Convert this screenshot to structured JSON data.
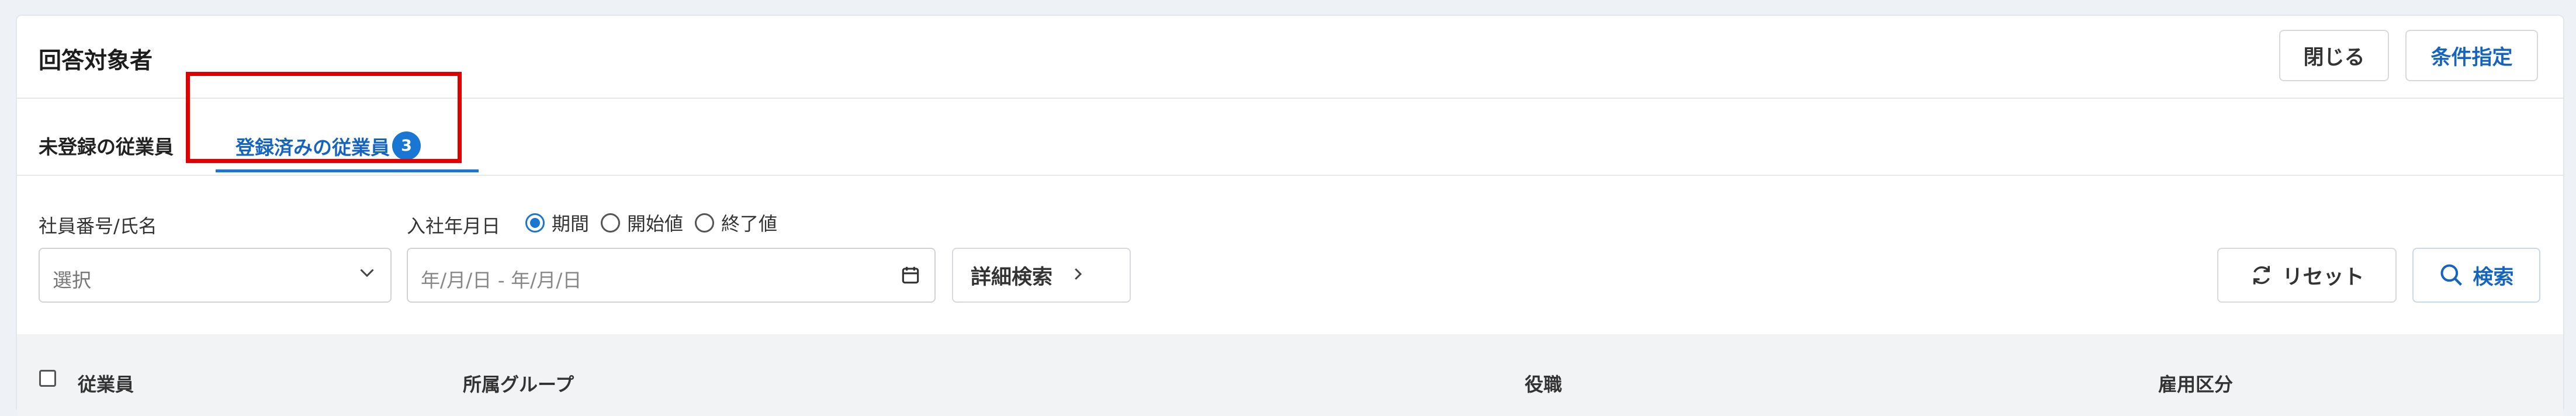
{
  "header": {
    "title": "回答対象者",
    "close_label": "閉じる",
    "condition_label": "条件指定"
  },
  "tabs": [
    {
      "label": "未登録の従業員"
    },
    {
      "label": "登録済みの従業員",
      "badge": "3",
      "active": true
    }
  ],
  "filters": {
    "employee_label": "社員番号/氏名",
    "employee_placeholder": "選択",
    "hire_date_label": "入社年月日",
    "radio_options": [
      {
        "label": "期間",
        "selected": true
      },
      {
        "label": "開始値",
        "selected": false
      },
      {
        "label": "終了値",
        "selected": false
      }
    ],
    "date_placeholder": "年/月/日  -  年/月/日",
    "detail_search_label": "詳細検索",
    "reset_label": "リセット",
    "search_label": "検索"
  },
  "table": {
    "columns": [
      "従業員",
      "所属グループ",
      "役職",
      "雇用区分"
    ]
  },
  "colors": {
    "accent": "#1976d2",
    "highlight": "#e00000"
  }
}
